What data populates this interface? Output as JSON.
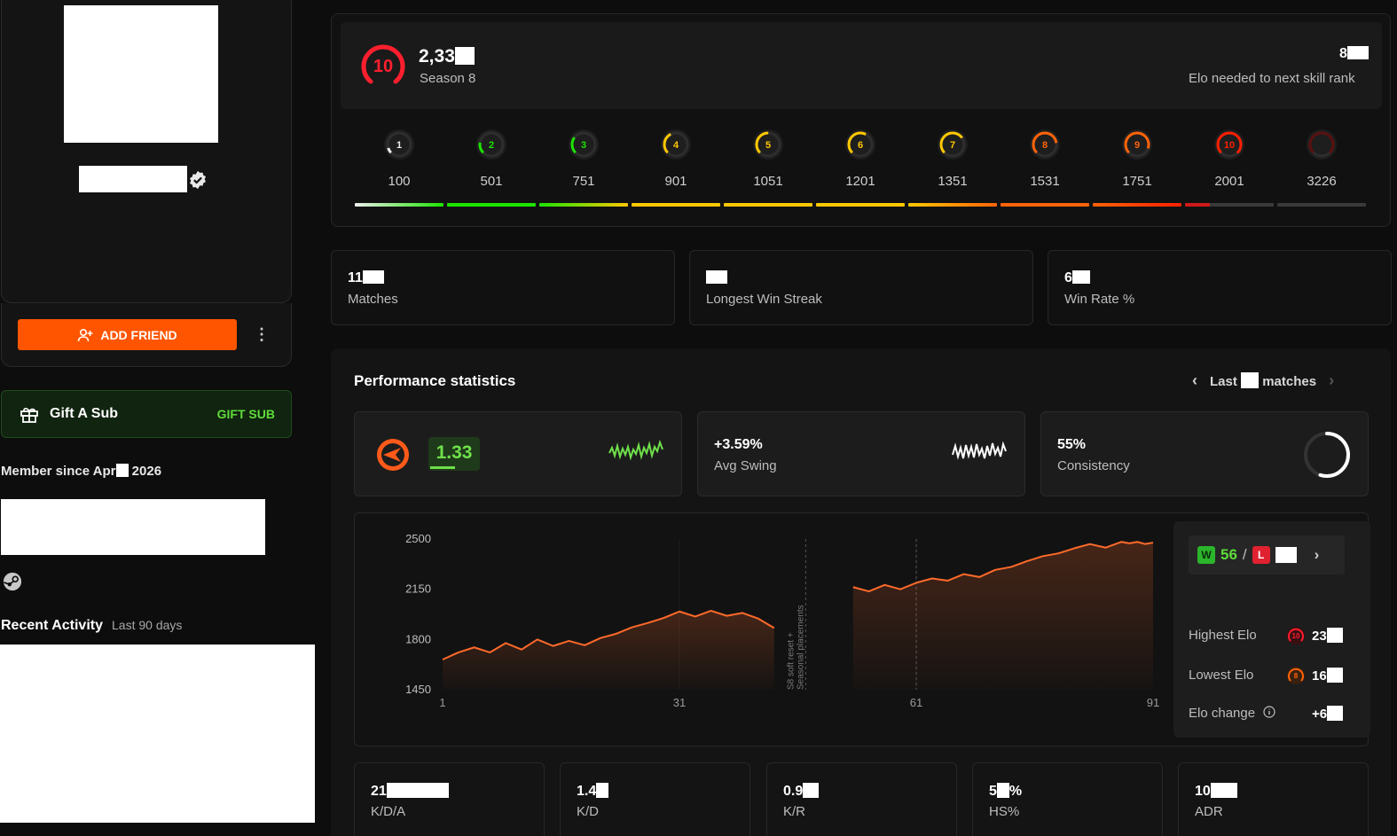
{
  "profile": {
    "add_friend_label": "ADD FRIEND",
    "more_label": "⋮",
    "gift": {
      "title": "Gift A Sub",
      "button": "GIFT SUB"
    },
    "member_since_prefix": "Member since Apr",
    "member_since_suffix": "2026",
    "recent_activity": {
      "title": "Recent Activity",
      "subtitle": "Last 90 days"
    }
  },
  "skill": {
    "current_level": "10",
    "elo_prefix": "2,33",
    "season": "Season 8",
    "needed_prefix": "8",
    "needed_label": "Elo needed to next skill rank",
    "levels": [
      {
        "level": "1",
        "min": "100",
        "color": "#eeeeee"
      },
      {
        "level": "2",
        "min": "501",
        "color": "#1ce400"
      },
      {
        "level": "3",
        "min": "751",
        "color": "#1ce400"
      },
      {
        "level": "4",
        "min": "901",
        "color": "#ffc800"
      },
      {
        "level": "5",
        "min": "1051",
        "color": "#ffc800"
      },
      {
        "level": "6",
        "min": "1201",
        "color": "#ffc800"
      },
      {
        "level": "7",
        "min": "1351",
        "color": "#ffc800"
      },
      {
        "level": "8",
        "min": "1531",
        "color": "#ff6309"
      },
      {
        "level": "9",
        "min": "1751",
        "color": "#ff6309"
      },
      {
        "level": "10",
        "min": "2001",
        "color": "#fe1f00"
      },
      {
        "level": "",
        "min": "3226",
        "color": "#5a1010"
      }
    ]
  },
  "stats": {
    "matches": {
      "value_prefix": "11",
      "label": "Matches"
    },
    "longest_streak": {
      "value_prefix": "",
      "label": "Longest Win Streak"
    },
    "win_rate": {
      "value_prefix": "6",
      "label": "Win Rate %"
    }
  },
  "performance": {
    "title": "Performance statistics",
    "nav_prefix": "Last",
    "nav_suffix": "matches",
    "rating": "1.33",
    "avg_swing": {
      "value": "+3.59%",
      "label": "Avg Swing"
    },
    "consistency": {
      "value": "55%",
      "label": "Consistency",
      "fraction": 0.55
    },
    "wins": "56",
    "win_badge": "W",
    "loss_badge": "L",
    "slash": "/",
    "highest_elo": {
      "label": "Highest Elo",
      "level": "10",
      "value_prefix": "23"
    },
    "lowest_elo": {
      "label": "Lowest Elo",
      "level": "8",
      "value_prefix": "16"
    },
    "elo_change": {
      "label": "Elo change",
      "value_prefix": "+6"
    }
  },
  "chart_data": {
    "type": "area",
    "y_ticks": [
      "2500",
      "2150",
      "1800",
      "1450"
    ],
    "x_ticks": [
      "1",
      "31",
      "61",
      "91"
    ],
    "ylim": [
      1450,
      2500
    ],
    "xlim": [
      1,
      91
    ],
    "annotation_line1": "S8 soft reset +",
    "annotation_line2": "Seasonal placements",
    "segment1": {
      "x": [
        1,
        3,
        5,
        7,
        9,
        11,
        13,
        15,
        17,
        19,
        21,
        23,
        25,
        27,
        29,
        31,
        33,
        35,
        37,
        39,
        41,
        43
      ],
      "y": [
        1660,
        1710,
        1745,
        1710,
        1775,
        1730,
        1800,
        1755,
        1790,
        1760,
        1810,
        1840,
        1885,
        1915,
        1950,
        1995,
        1960,
        2000,
        1965,
        1985,
        1945,
        1880
      ]
    },
    "segment2": {
      "x": [
        53,
        55,
        57,
        59,
        61,
        63,
        65,
        67,
        69,
        71,
        73,
        75,
        77,
        79,
        81,
        83,
        85,
        87,
        88,
        89,
        90,
        91
      ],
      "y": [
        2165,
        2135,
        2180,
        2150,
        2195,
        2225,
        2210,
        2255,
        2235,
        2285,
        2305,
        2345,
        2380,
        2400,
        2435,
        2465,
        2440,
        2480,
        2470,
        2480,
        2465,
        2475
      ]
    },
    "color": "#ff6a2b"
  },
  "bottom_stats": [
    {
      "value_prefix": "21",
      "label": "K/D/A"
    },
    {
      "value_prefix": "1.4",
      "label": "K/D"
    },
    {
      "value_prefix": "0.9",
      "label": "K/R"
    },
    {
      "value_prefix": "5",
      "value_suffix": "%",
      "label": "HS%"
    },
    {
      "value_prefix": "10",
      "label": "ADR"
    }
  ]
}
